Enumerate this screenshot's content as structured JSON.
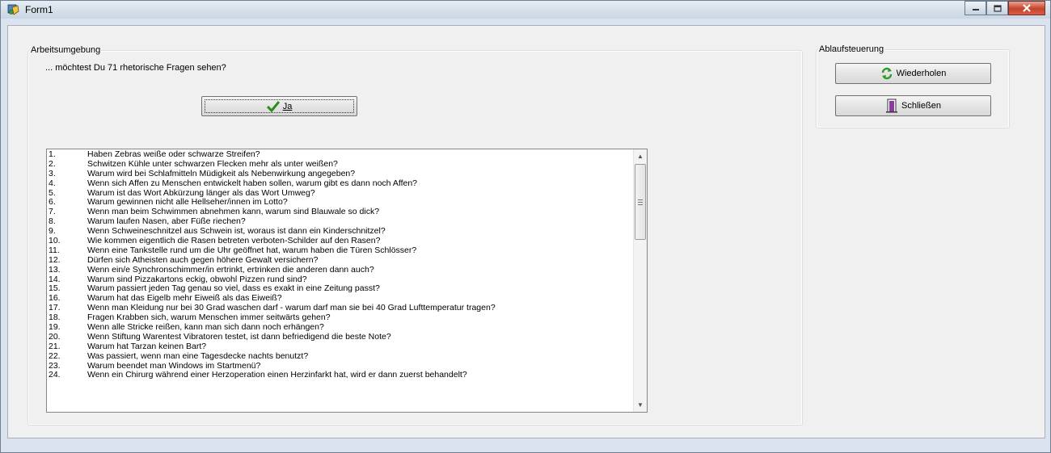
{
  "window": {
    "title": "Form1"
  },
  "icons": {
    "app": "app-icon",
    "minimize": "minimize-icon",
    "maximize": "maximize-icon",
    "close": "close-icon",
    "ja": "checkmark-icon",
    "repeat": "refresh-icon",
    "close_app": "exit-door-icon"
  },
  "colors": {
    "checkmark": "#2e8b1f",
    "refresh": "#2a9a2a",
    "exit": "#8a3aa0"
  },
  "work_area": {
    "legend": "Arbeitsumgebung",
    "prompt": "... möchtest Du 71 rhetorische Fragen sehen?",
    "ja_label": "Ja",
    "questions": [
      {
        "num": "1.",
        "text": "Haben Zebras weiße oder schwarze Streifen?"
      },
      {
        "num": "2.",
        "text": "Schwitzen Kühle unter schwarzen Flecken mehr als unter weißen?"
      },
      {
        "num": "3.",
        "text": "Warum wird bei Schlafmitteln Müdigkeit als Nebenwirkung angegeben?"
      },
      {
        "num": "4.",
        "text": "Wenn sich Affen zu Menschen entwickelt haben sollen, warum gibt es dann noch Affen?"
      },
      {
        "num": "5.",
        "text": "Warum ist das Wort Abkürzung länger als das Wort Umweg?"
      },
      {
        "num": "6.",
        "text": "Warum gewinnen nicht alle Hellseher/innen im Lotto?"
      },
      {
        "num": "7.",
        "text": "Wenn man beim Schwimmen abnehmen kann, warum sind Blauwale so dick?"
      },
      {
        "num": "8.",
        "text": "Warum laufen Nasen, aber Füße riechen?"
      },
      {
        "num": "9.",
        "text": "Wenn Schweineschnitzel aus Schwein ist, woraus ist dann ein Kinderschnitzel?"
      },
      {
        "num": "10.",
        "text": "Wie kommen eigentlich die Rasen betreten verboten-Schilder auf den Rasen?"
      },
      {
        "num": "11.",
        "text": "Wenn eine Tankstelle rund um die Uhr geöffnet hat, warum haben die Türen Schlösser?"
      },
      {
        "num": "12.",
        "text": "Dürfen sich Atheisten auch gegen höhere Gewalt versichern?"
      },
      {
        "num": "13.",
        "text": "Wenn ein/e Synchronschimmer/in ertrinkt, ertrinken die anderen dann auch?"
      },
      {
        "num": "14.",
        "text": "Warum sind Pizzakartons eckig, obwohl Pizzen rund sind?"
      },
      {
        "num": "15.",
        "text": "Warum passiert jeden Tag genau so viel, dass es exakt in eine Zeitung passt?"
      },
      {
        "num": "16.",
        "text": "Warum hat das Eigelb mehr Eiweiß als das Eiweiß?"
      },
      {
        "num": "17.",
        "text": "Wenn man Kleidung nur bei 30 Grad waschen darf - warum darf man sie bei 40 Grad Lufttemperatur tragen?"
      },
      {
        "num": "18.",
        "text": "Fragen Krabben sich, warum Menschen immer seitwärts gehen?"
      },
      {
        "num": "19.",
        "text": "Wenn alle Stricke reißen, kann man sich dann noch erhängen?"
      },
      {
        "num": "20.",
        "text": "Wenn Stiftung Warentest Vibratoren testet, ist dann befriedigend die beste Note?"
      },
      {
        "num": "21.",
        "text": "Warum hat Tarzan keinen Bart?"
      },
      {
        "num": "22.",
        "text": "Was passiert, wenn man eine Tagesdecke nachts benutzt?"
      },
      {
        "num": "23.",
        "text": "Warum beendet man Windows im Startmenü?"
      },
      {
        "num": "24.",
        "text": "Wenn ein Chirurg während einer Herzoperation einen Herzinfarkt hat, wird er dann zuerst behandelt?"
      }
    ]
  },
  "flow_control": {
    "legend": "Ablaufsteuerung",
    "repeat_label": "Wiederholen",
    "close_label": "Schließen"
  }
}
